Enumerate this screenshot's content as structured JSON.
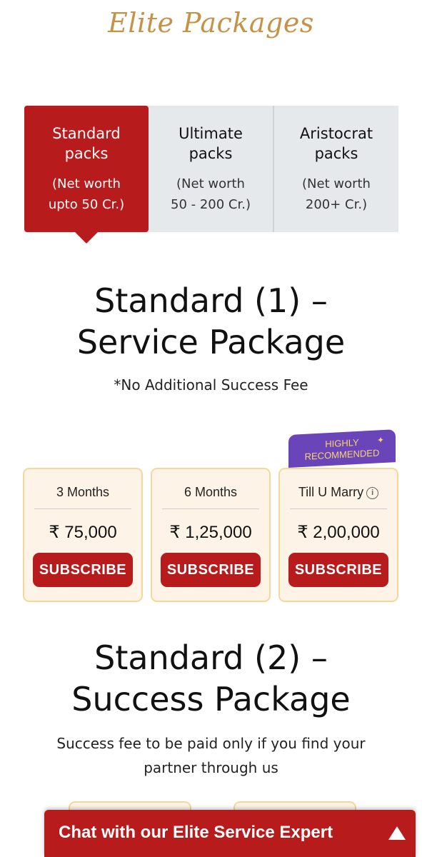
{
  "page": {
    "title": "Elite Packages"
  },
  "tabs": [
    {
      "label_line1": "Standard",
      "label_line2": "packs",
      "sub_line1": "(Net worth",
      "sub_line2": "upto 50 Cr.)",
      "active": true
    },
    {
      "label_line1": "Ultimate",
      "label_line2": "packs",
      "sub_line1": "(Net worth",
      "sub_line2": "50 - 200 Cr.)",
      "active": false
    },
    {
      "label_line1": "Aristocrat",
      "label_line2": "packs",
      "sub_line1": "(Net worth",
      "sub_line2": "200+ Cr.)",
      "active": false
    }
  ],
  "section1": {
    "heading_line1": "Standard (1) –",
    "heading_line2": "Service Package",
    "note": "*No Additional Success Fee"
  },
  "ribbon": {
    "line1": "HIGHLY",
    "line2": "RECOMMENDED",
    "icon": "sparkle-icon"
  },
  "plans": [
    {
      "name": "3 Months",
      "price": "₹ 75,000",
      "button": "SUBSCRIBE"
    },
    {
      "name": "6 Months",
      "price": "₹ 1,25,000",
      "button": "SUBSCRIBE"
    },
    {
      "name": "Till U Marry",
      "price": "₹ 2,00,000",
      "button": "SUBSCRIBE",
      "info_icon": "i"
    }
  ],
  "section2": {
    "heading_line1": "Standard (2) –",
    "heading_line2": "Success Package",
    "desc_line1": "Success fee to be paid only if you find your",
    "desc_line2": "partner through us"
  },
  "chat": {
    "label": "Chat with our Elite Service Expert",
    "icon": "chevron-up-icon"
  },
  "colors": {
    "brand_red": "#b71b1c",
    "gold": "#c69247",
    "card_bg": "#fdf4e7",
    "card_border": "#f4d79a",
    "ribbon_purple": "#6a44b9",
    "tab_bg": "#e6e9ec"
  }
}
